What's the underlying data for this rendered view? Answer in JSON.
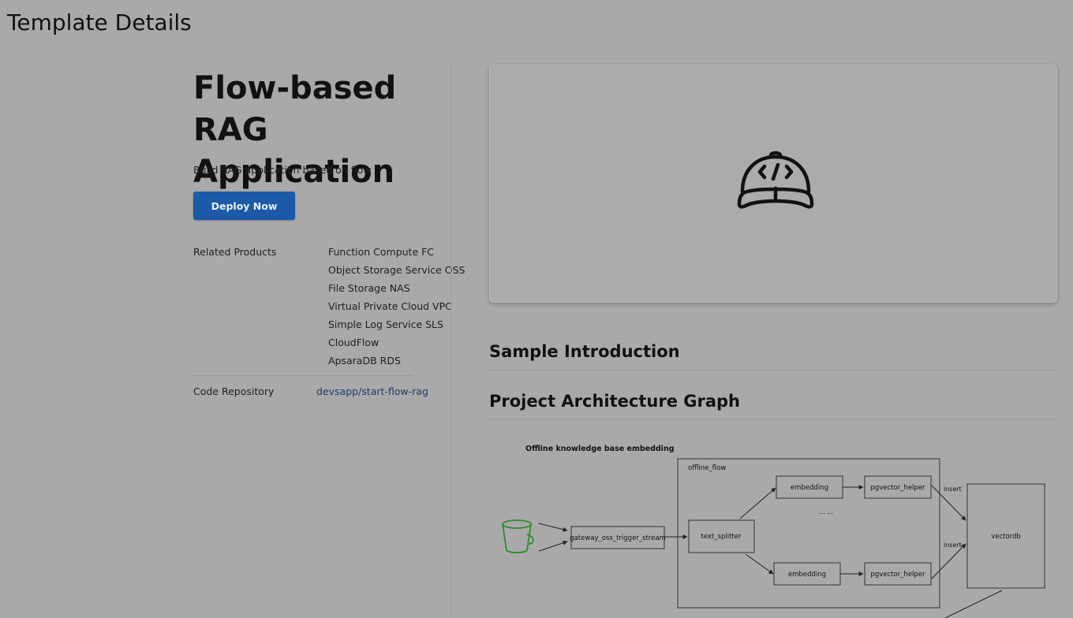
{
  "window": {
    "title": "Template Details"
  },
  "template": {
    "title": "Flow-based RAG Application",
    "subtitle": "Build RAG application based on flow",
    "deploy_label": "Deploy Now",
    "related_label": "Related Products",
    "related_products": [
      "Function Compute FC",
      "Object Storage Service OSS",
      "File Storage NAS",
      "Virtual Private Cloud VPC",
      "Simple Log Service SLS",
      "CloudFlow",
      "ApsaraDB RDS"
    ],
    "repo_label": "Code Repository",
    "repo_link": "devsapp/start-flow-rag"
  },
  "hero": {
    "icon": "cap-code-icon"
  },
  "sections": {
    "intro": "Sample Introduction",
    "architecture": "Project Architecture Graph"
  },
  "diagram": {
    "heading": "Offline knowledge base embedding",
    "group_label": "offline_flow",
    "trigger": "gateway_oss_trigger_stream",
    "splitter": "text_splitter",
    "embedding_top": "embedding",
    "embedding_bottom": "embedding",
    "helper_top": "pgvector_helper",
    "helper_bottom": "pgvector_helper",
    "ellipsis": "... ...",
    "insert_top": "insert",
    "insert_bottom": "insert",
    "store": "vectordb",
    "bucket_icon": "bucket-icon",
    "accent": "#2e8b2e"
  }
}
